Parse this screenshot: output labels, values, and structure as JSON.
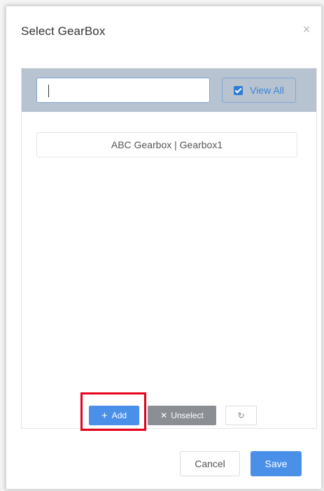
{
  "dialog": {
    "title": "Select GearBox",
    "close_glyph": "×"
  },
  "search": {
    "value": "",
    "view_all_label": "View All",
    "view_all_checked": true
  },
  "list": {
    "items": [
      {
        "label": "ABC Gearbox | Gearbox1"
      }
    ]
  },
  "actions": {
    "add_label": "Add",
    "add_icon": "plus-icon",
    "unselect_label": "Unselect",
    "unselect_icon": "close-icon",
    "refresh_icon": "refresh-icon",
    "refresh_glyph": "↻"
  },
  "footer": {
    "cancel_label": "Cancel",
    "save_label": "Save"
  },
  "colors": {
    "primary": "#4a90e8",
    "search_bar_bg": "#b8c3d1",
    "unselect_bg": "#8b8f94",
    "highlight": "#e8001c"
  }
}
